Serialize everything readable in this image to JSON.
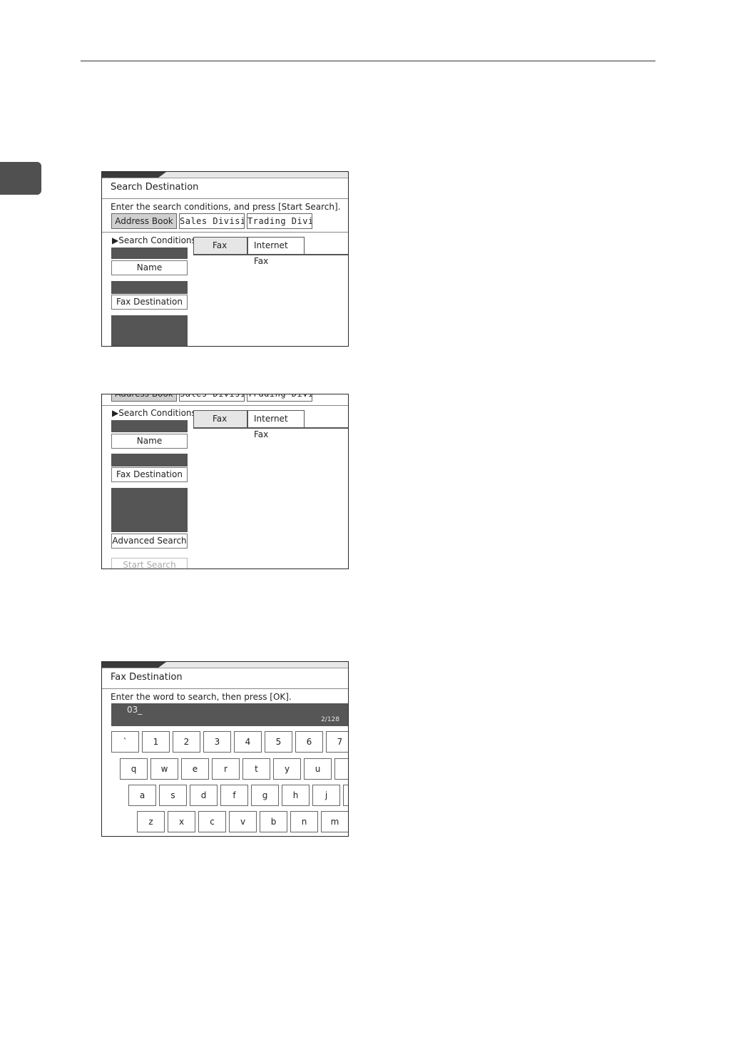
{
  "shot1": {
    "title": "Search Destination",
    "instruction": "Enter the search conditions, and press [Start Search].",
    "tabs": [
      "Address Book",
      "Sales Division",
      "Trading Divis.."
    ],
    "search_conditions_label": "▶Search Conditions",
    "condition_buttons": [
      "Name",
      "Fax Destination"
    ],
    "dest_tabs": [
      "Fax",
      "Internet Fax"
    ]
  },
  "shot2": {
    "top_tabs": [
      "Address Book",
      "Sales Division",
      "Trading Divis.."
    ],
    "search_conditions_label": "▶Search Conditions",
    "condition_buttons": [
      "Name",
      "Fax Destination"
    ],
    "advanced_search": "Advanced Search",
    "start_search": "Start Search",
    "dest_tabs": [
      "Fax",
      "Internet Fax"
    ]
  },
  "shot3": {
    "title": "Fax Destination",
    "instruction": "Enter the word to search, then press [OK].",
    "input_value": "03_",
    "char_count": "2/128",
    "keyboard": {
      "row1": [
        "`",
        "1",
        "2",
        "3",
        "4",
        "5",
        "6",
        "7"
      ],
      "row2": [
        "q",
        "w",
        "e",
        "r",
        "t",
        "y",
        "u",
        ""
      ],
      "row3": [
        "a",
        "s",
        "d",
        "f",
        "g",
        "h",
        "j",
        ""
      ],
      "row4": [
        "z",
        "x",
        "c",
        "v",
        "b",
        "n",
        "m"
      ]
    }
  }
}
